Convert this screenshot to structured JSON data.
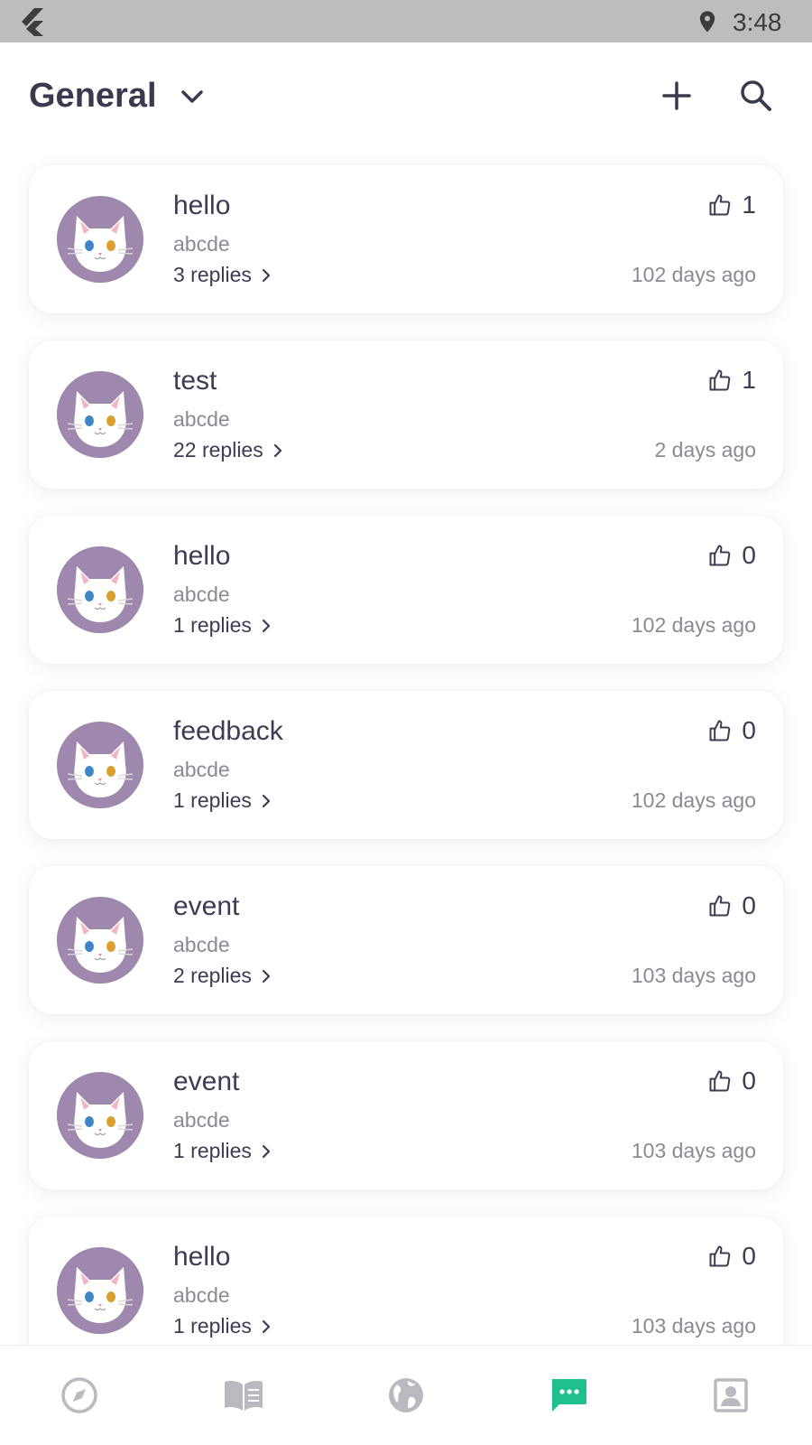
{
  "status_bar": {
    "time": "3:48"
  },
  "header": {
    "title": "General"
  },
  "colors": {
    "accent": "#1fc090",
    "avatar_bg": "#9f88ae",
    "inactive_icon": "#b9b9bf",
    "text_dark": "#3c3c52",
    "text_muted": "#8a8a95"
  },
  "posts": [
    {
      "title": "hello",
      "author": "abcde",
      "replies": "3 replies",
      "likes": "1",
      "time": "102 days ago"
    },
    {
      "title": "test",
      "author": "abcde",
      "replies": "22 replies",
      "likes": "1",
      "time": "2 days ago"
    },
    {
      "title": "hello",
      "author": "abcde",
      "replies": "1 replies",
      "likes": "0",
      "time": "102 days ago"
    },
    {
      "title": "feedback",
      "author": "abcde",
      "replies": "1 replies",
      "likes": "0",
      "time": "102 days ago"
    },
    {
      "title": "event",
      "author": "abcde",
      "replies": "2 replies",
      "likes": "0",
      "time": "103 days ago"
    },
    {
      "title": "event",
      "author": "abcde",
      "replies": "1 replies",
      "likes": "0",
      "time": "103 days ago"
    },
    {
      "title": "hello",
      "author": "abcde",
      "replies": "1 replies",
      "likes": "0",
      "time": "103 days ago"
    }
  ],
  "bottom_nav": [
    {
      "icon": "compass-icon",
      "active": false
    },
    {
      "icon": "book-icon",
      "active": false
    },
    {
      "icon": "globe-icon",
      "active": false
    },
    {
      "icon": "chat-icon",
      "active": true
    },
    {
      "icon": "profile-icon",
      "active": false
    }
  ]
}
